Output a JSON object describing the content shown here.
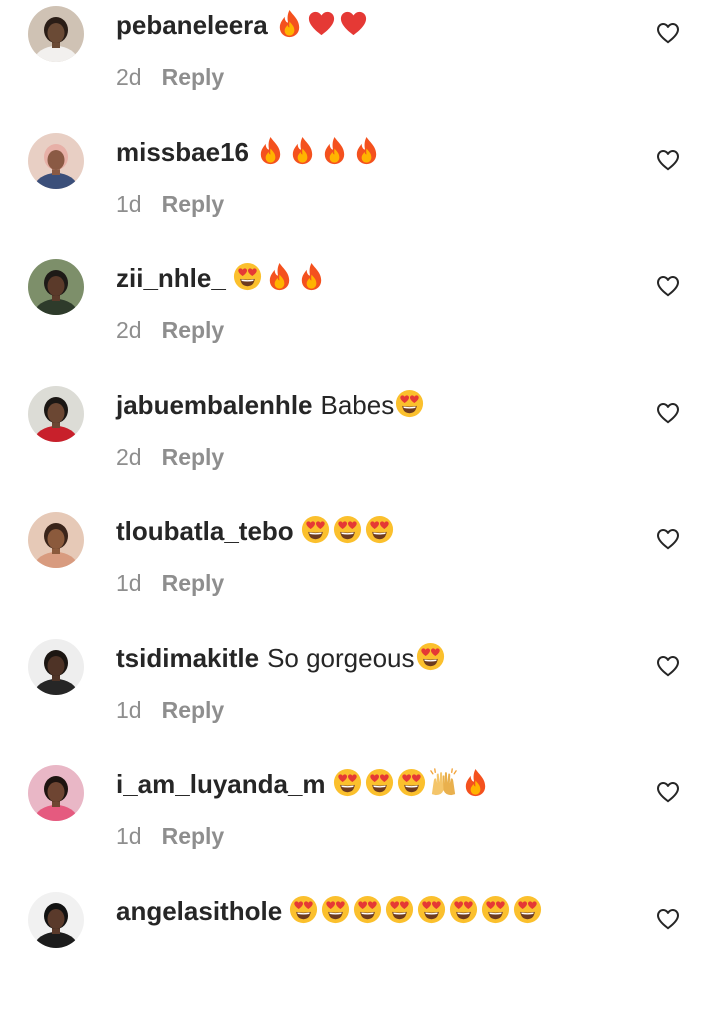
{
  "comments": [
    {
      "username": "pebaneleera",
      "text": "",
      "emojis": [
        "fire",
        "red-heart",
        "red-heart"
      ],
      "time": "2d",
      "reply_label": "Reply",
      "avatar": {
        "bg": "#cfc2b4",
        "skin": "#6a4a35",
        "hair": "#2a1d16",
        "cloth": "#f2f0ee"
      }
    },
    {
      "username": "missbae16",
      "text": "",
      "emojis": [
        "fire",
        "fire",
        "fire",
        "fire"
      ],
      "time": "1d",
      "reply_label": "Reply",
      "avatar": {
        "bg": "#e8cfc4",
        "skin": "#8a5a44",
        "hair": "#e7b0a7",
        "cloth": "#3b4f7a"
      }
    },
    {
      "username": "zii_nhle_",
      "text": "",
      "emojis": [
        "heart-eyes",
        "fire",
        "fire"
      ],
      "time": "2d",
      "reply_label": "Reply",
      "avatar": {
        "bg": "#7d8f6a",
        "skin": "#5b3a2a",
        "hair": "#1e1a17",
        "cloth": "#2e3b2b"
      }
    },
    {
      "username": "jabuembalenhle",
      "text": "Babes",
      "emojis": [
        "heart-eyes"
      ],
      "time": "2d",
      "reply_label": "Reply",
      "avatar": {
        "bg": "#dcdcd6",
        "skin": "#6b4733",
        "hair": "#1b1714",
        "cloth": "#c8202b"
      }
    },
    {
      "username": "tloubatla_tebo",
      "text": "",
      "emojis": [
        "heart-eyes",
        "heart-eyes",
        "heart-eyes"
      ],
      "time": "1d",
      "reply_label": "Reply",
      "avatar": {
        "bg": "#e6c9b7",
        "skin": "#8b5a3c",
        "hair": "#3a241a",
        "cloth": "#d89b7f"
      }
    },
    {
      "username": "tsidimakitle",
      "text": "So gorgeous",
      "emojis": [
        "heart-eyes"
      ],
      "time": "1d",
      "reply_label": "Reply",
      "avatar": {
        "bg": "#eeeeee",
        "skin": "#4e3326",
        "hair": "#1c1612",
        "cloth": "#262626"
      }
    },
    {
      "username": "i_am_luyanda_m",
      "text": "",
      "emojis": [
        "heart-eyes",
        "heart-eyes",
        "heart-eyes",
        "raising-hands",
        "fire"
      ],
      "time": "1d",
      "reply_label": "Reply",
      "avatar": {
        "bg": "#e9b7c6",
        "skin": "#6e4532",
        "hair": "#1e1410",
        "cloth": "#e55a7f"
      }
    },
    {
      "username": "angelasithole",
      "text": "",
      "emojis": [
        "heart-eyes",
        "heart-eyes",
        "heart-eyes",
        "heart-eyes",
        "heart-eyes",
        "heart-eyes",
        "heart-eyes",
        "heart-eyes"
      ],
      "time": "",
      "reply_label": "",
      "avatar": {
        "bg": "#f1f1f1",
        "skin": "#5a3a2b",
        "hair": "#121212",
        "cloth": "#1c1c1c"
      }
    }
  ],
  "colors": {
    "text": "#262626",
    "secondary": "#8e8e8e",
    "fire_outer": "#f4511e",
    "fire_inner": "#ffb300",
    "heart": "#e53935",
    "emoji_face": "#fbc02d"
  },
  "icons": {
    "like": "heart-outline-icon"
  }
}
